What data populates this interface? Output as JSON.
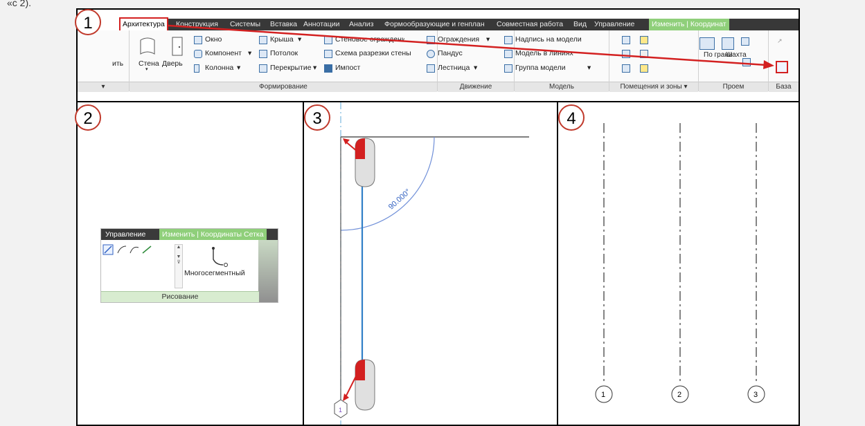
{
  "top_fragment": "«с 2).",
  "ribbon": {
    "tabs": [
      "Архитектура",
      "Конструкция",
      "Системы",
      "Вставка",
      "Аннотации",
      "Анализ",
      "Формообразующие и генплан",
      "Совместная работа",
      "Вид",
      "Управление",
      "Изменить | Координат"
    ],
    "left_cut_label": "ить",
    "wall_label": "Стена",
    "door_label": "Дверь",
    "window_label": "Окно",
    "component_label": "Компонент",
    "column_label": "Колонна",
    "roof_label": "Крыша",
    "ceiling_label": "Потолок",
    "floor_label": "Перекрытие",
    "curtain_system_label": "Стеновое ограждение",
    "curtain_grid_label": "Схема разрезки стены",
    "mullion_label": "Импост",
    "railing_label": "Ограждения",
    "ramp_label": "Пандус",
    "stair_label": "Лестница",
    "model_text_label": "Надпись на модели",
    "model_line_label": "Модель в линиях",
    "model_group_label": "Группа модели",
    "by_face_label": "По грани",
    "shaft_label": "Шахта",
    "groups": [
      "Формирование",
      "Движение",
      "Модель",
      "Помещения и зоны",
      "Проем",
      "База"
    ]
  },
  "callouts": [
    "1",
    "2",
    "3",
    "4"
  ],
  "panel2": {
    "tabs": [
      "Управление",
      "Изменить | Координаты Сетка"
    ],
    "multisegment_label": "Многосегментный",
    "draw_group": "Рисование"
  },
  "panel3": {
    "angle_label": "90.000°",
    "grid_bubble": "1"
  },
  "panel4": {
    "grid_labels": [
      "1",
      "2",
      "3"
    ]
  },
  "colors": {
    "callout_border": "#c0392b",
    "arrow_red": "#d32020",
    "arrow_blue": "#2f7fc7",
    "highlight_green": "#8fcf7a"
  }
}
